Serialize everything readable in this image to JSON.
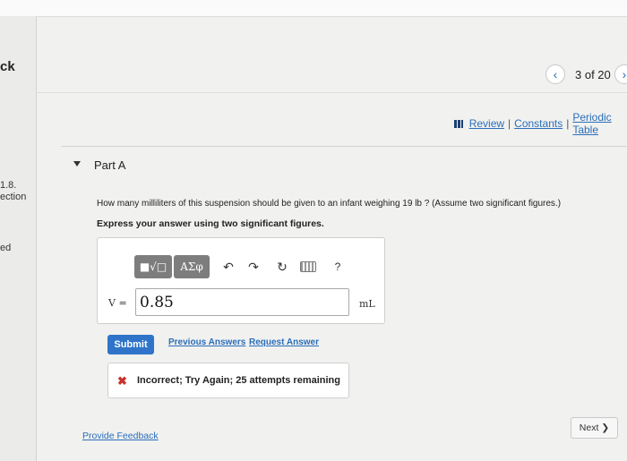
{
  "colors": {
    "link": "#2a6ebb",
    "submit": "#2f74c9",
    "error": "#c8322a",
    "toolbar": "#7d7d7d"
  },
  "back_label": "ck",
  "nav": {
    "prev_icon": "‹",
    "counter": "3 of 20",
    "next_icon": "›"
  },
  "links": {
    "review": "Review",
    "constants": "Constants",
    "periodic_table": "Periodic Table",
    "separator": "|"
  },
  "part": {
    "title": "Part A"
  },
  "sidebar": {
    "section_num": "1.8.",
    "section_label": "ection",
    "ed_label": "ed"
  },
  "question": {
    "text": "How many milliliters of this suspension should be given to an infant weighing 19 lb ? (Assume two significant figures.)",
    "instruction": "Express your answer using two significant figures."
  },
  "toolbar": {
    "templates": "■√□",
    "greek": "ΑΣφ",
    "undo_icon": "↶",
    "redo_icon": "↷",
    "reset_icon": "↻",
    "help": "?"
  },
  "answer": {
    "variable": "V =",
    "value": "0.85",
    "unit": "mL"
  },
  "actions": {
    "submit": "Submit",
    "previous_answers": "Previous Answers",
    "request_answer": "Request Answer"
  },
  "feedback": {
    "icon": "✖",
    "message": "Incorrect; Try Again; 25 attempts remaining"
  },
  "footer": {
    "provide_feedback": "Provide Feedback",
    "next": "Next",
    "next_icon": "❯"
  }
}
